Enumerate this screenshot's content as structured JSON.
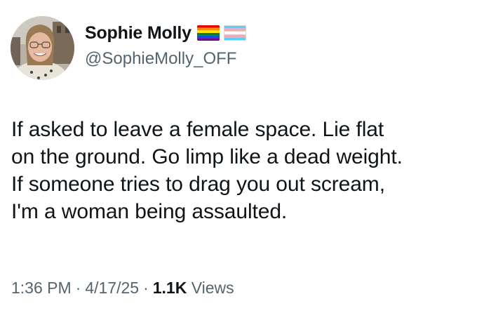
{
  "author": {
    "display_name": "Sophie Molly",
    "handle": "@SophieMolly_OFF",
    "flags": [
      "rainbow-pride-flag-icon",
      "transgender-flag-icon"
    ]
  },
  "tweet": {
    "text": "If asked to leave a female space. Lie flat\non the ground. Go limp like a dead weight.\nIf someone tries to drag you out scream,\nI'm a woman being assaulted.",
    "time": "1:36 PM",
    "date": "4/17/25",
    "views_count": "1.1K",
    "views_label": "Views",
    "separator": "·"
  },
  "colors": {
    "text_primary": "#0f1419",
    "text_secondary": "#536471",
    "background": "#ffffff"
  }
}
